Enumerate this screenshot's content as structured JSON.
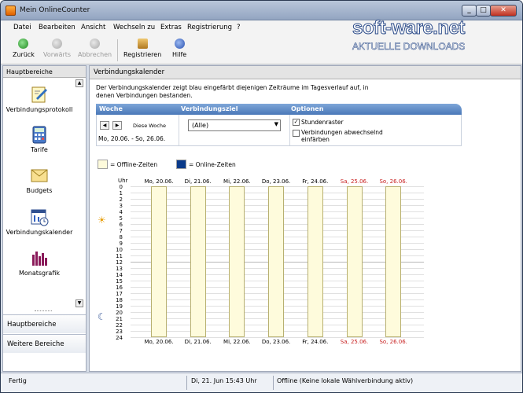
{
  "window": {
    "title": "Mein OnlineCounter"
  },
  "menu": [
    "Datei",
    "Bearbeiten",
    "Ansicht",
    "Wechseln zu",
    "Extras",
    "Registrierung",
    "?"
  ],
  "toolbar": {
    "back": "Zurück",
    "forward": "Vorwärts",
    "cancel": "Abbrechen",
    "register": "Registrieren",
    "help": "Hilfe"
  },
  "watermark": {
    "line1": "soft-ware.net",
    "line2": "AKTUELLE DOWNLOADS"
  },
  "sidebar": {
    "header": "Hauptbereiche",
    "items": [
      "Verbindungsprotokoll",
      "Tarife",
      "Budgets",
      "Verbindungskalender",
      "Monatsgrafik"
    ],
    "sections": [
      "Hauptbereiche",
      "Weitere Bereiche"
    ]
  },
  "main": {
    "title": "Verbindungskalender",
    "description": "Der Verbindungskalender zeigt blau eingefärbt diejenigen Zeiträume im Tagesverlauf auf, in denen Verbindungen bestanden.",
    "filters": {
      "woche_label": "Woche",
      "verbindungsziel_label": "Verbindungsziel",
      "optionen_label": "Optionen",
      "this_week": "Diese Woche",
      "date_range": "Mo, 20.06. - So, 26.06.",
      "target_value": "(Alle)",
      "option1": "Stundenraster",
      "option1_checked": true,
      "option2": "Verbindungen abwechselnd einfärben",
      "option2_checked": false
    },
    "legend": {
      "offline": "= Offline-Zeiten",
      "online": "= Online-Zeiten",
      "offline_color": "#fefbdc",
      "online_color": "#0a3a8a"
    },
    "calendar": {
      "unit_label": "Uhr",
      "hours": [
        "0",
        "1",
        "2",
        "3",
        "4",
        "5",
        "6",
        "7",
        "8",
        "9",
        "10",
        "11",
        "12",
        "13",
        "14",
        "15",
        "16",
        "17",
        "18",
        "19",
        "20",
        "21",
        "22",
        "23",
        "24"
      ],
      "days": [
        {
          "label": "Mo, 20.06.",
          "weekend": false
        },
        {
          "label": "Di, 21.06.",
          "weekend": false
        },
        {
          "label": "Mi, 22.06.",
          "weekend": false
        },
        {
          "label": "Do, 23.06.",
          "weekend": false
        },
        {
          "label": "Fr, 24.06.",
          "weekend": false
        },
        {
          "label": "Sa, 25.06.",
          "weekend": true
        },
        {
          "label": "So, 26.06.",
          "weekend": true
        }
      ]
    }
  },
  "status": {
    "left": "Fertig",
    "datetime": "Di, 21. Jun  15:43 Uhr",
    "connection": "Offline (Keine lokale Wählverbindung aktiv)"
  }
}
